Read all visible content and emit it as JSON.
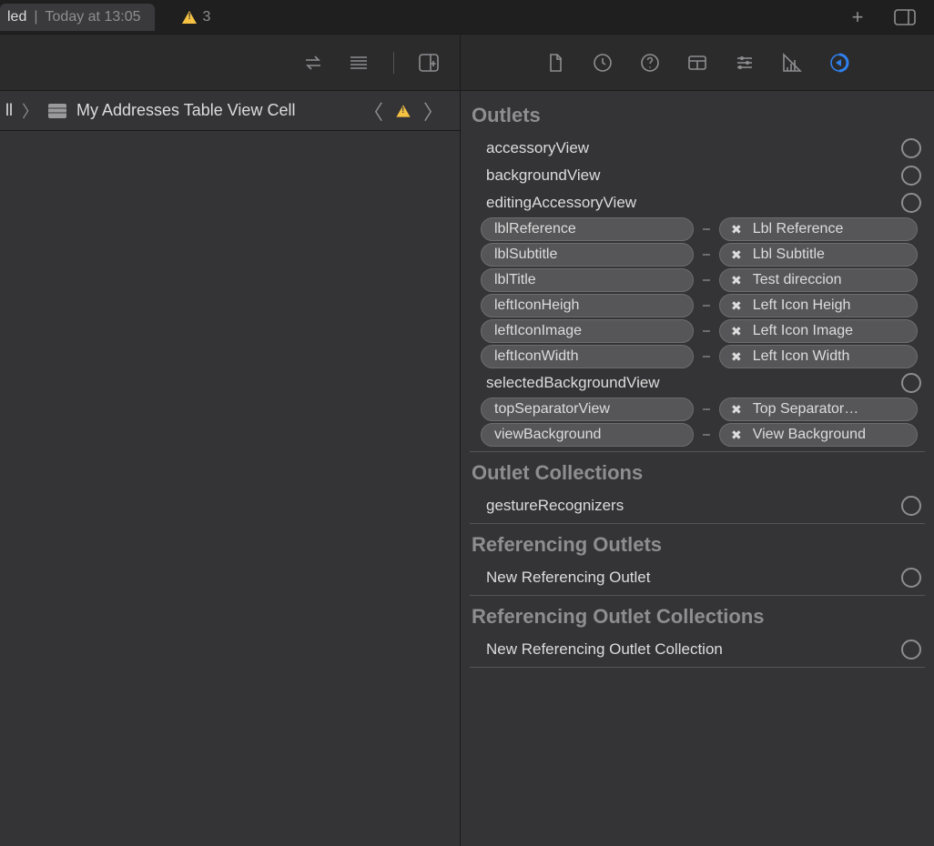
{
  "titlebar": {
    "tab_prefix": "led",
    "tab_separator": "|",
    "tab_time": "Today at 13:05",
    "warning_count": "3"
  },
  "breadcrumb": {
    "prefix": "ll",
    "item": "My Addresses Table View Cell"
  },
  "inspector": {
    "sections": {
      "outlets_title": "Outlets",
      "outlet_collections_title": "Outlet Collections",
      "referencing_outlets_title": "Referencing Outlets",
      "referencing_outlet_collections_title": "Referencing Outlet Collections"
    },
    "outlets_simple": {
      "accessoryView": "accessoryView",
      "backgroundView": "backgroundView",
      "editingAccessoryView": "editingAccessoryView",
      "selectedBackgroundView": "selectedBackgroundView"
    },
    "outlets_connected": [
      {
        "name": "lblReference",
        "conn": "Lbl Reference"
      },
      {
        "name": "lblSubtitle",
        "conn": "Lbl Subtitle"
      },
      {
        "name": "lblTitle",
        "conn": "Test direccion"
      },
      {
        "name": "leftIconHeigh",
        "conn": "Left Icon Heigh"
      },
      {
        "name": "leftIconImage",
        "conn": "Left Icon Image"
      },
      {
        "name": "leftIconWidth",
        "conn": "Left Icon Width"
      }
    ],
    "outlets_connected_after": [
      {
        "name": "topSeparatorView",
        "conn": "Top Separator…"
      },
      {
        "name": "viewBackground",
        "conn": "View Background"
      }
    ],
    "outlet_collections": {
      "gestureRecognizers": "gestureRecognizers"
    },
    "referencing_outlets": {
      "new": "New Referencing Outlet"
    },
    "referencing_outlet_collections": {
      "new": "New Referencing Outlet Collection"
    }
  }
}
